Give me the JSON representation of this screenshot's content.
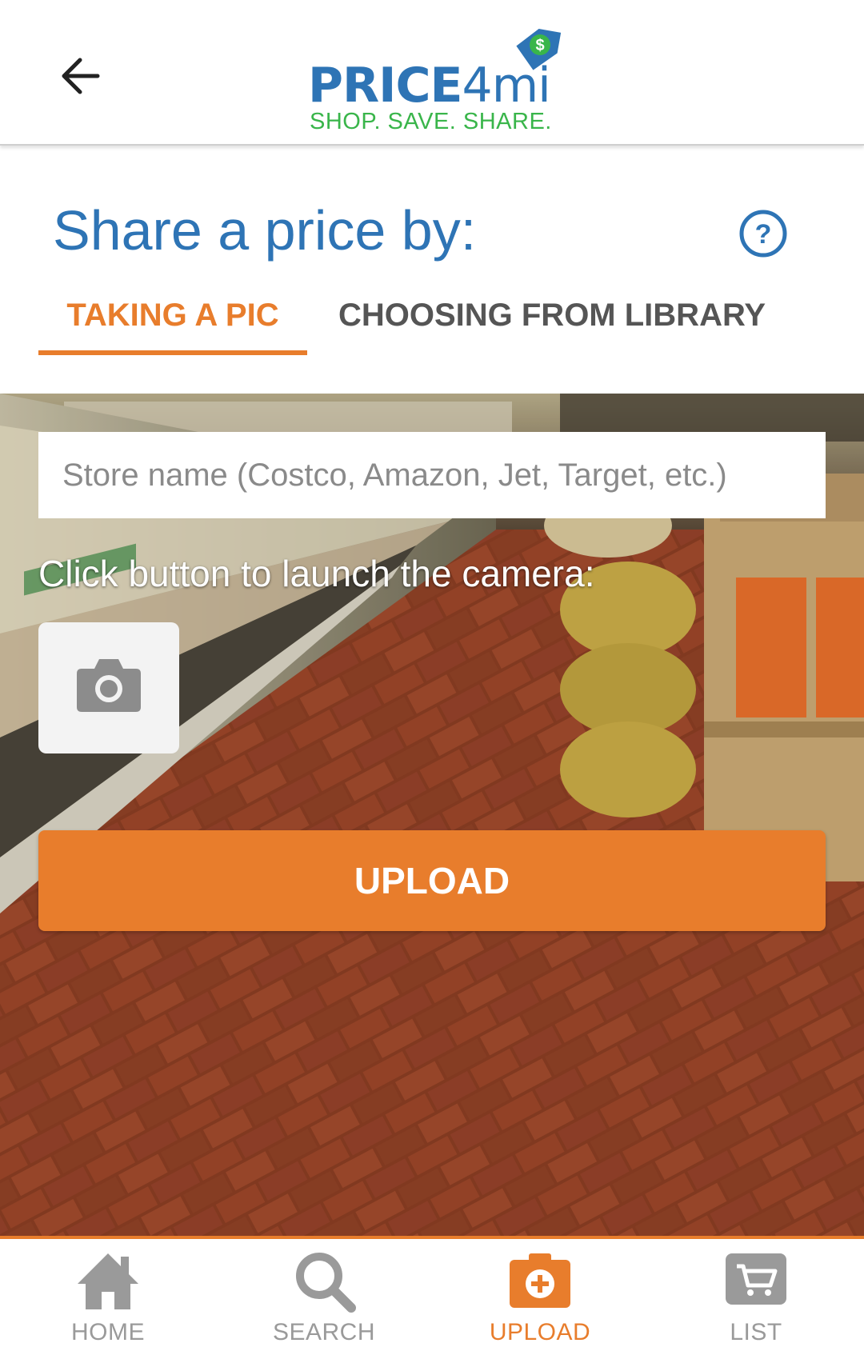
{
  "header": {
    "logo_text_bold": "PRICE",
    "logo_text_thin": "4mi",
    "logo_tagline": "SHOP. SAVE. SHARE.",
    "logo_tag_symbol": "$"
  },
  "page": {
    "title": "Share a price by:",
    "help_symbol": "?"
  },
  "tabs": [
    {
      "label": "TAKING A PIC",
      "active": true
    },
    {
      "label": "CHOOSING FROM LIBRARY",
      "active": false
    }
  ],
  "form": {
    "store_placeholder": "Store name (Costco, Amazon, Jet, Target, etc.)",
    "store_value": "",
    "camera_hint": "Click button to launch the camera:",
    "upload_label": "UPLOAD"
  },
  "bottom_nav": [
    {
      "label": "HOME",
      "icon": "home-icon",
      "active": false
    },
    {
      "label": "SEARCH",
      "icon": "search-icon",
      "active": false
    },
    {
      "label": "UPLOAD",
      "icon": "upload-camera-icon",
      "active": true
    },
    {
      "label": "LIST",
      "icon": "cart-icon",
      "active": false
    }
  ],
  "colors": {
    "accent": "#e87d2c",
    "brand_blue": "#2e74b5",
    "brand_green": "#39b54a",
    "inactive": "#9a9a9a"
  }
}
